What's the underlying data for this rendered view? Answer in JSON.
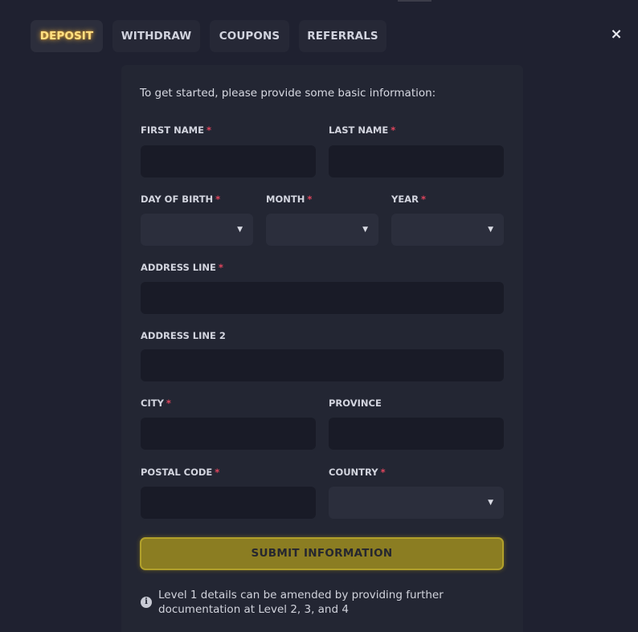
{
  "tabs": [
    {
      "label": "DEPOSIT",
      "active": true
    },
    {
      "label": "WITHDRAW",
      "active": false
    },
    {
      "label": "COUPONS",
      "active": false
    },
    {
      "label": "REFERRALS",
      "active": false
    }
  ],
  "close_icon": "×",
  "form": {
    "intro": "To get started, please provide some basic information:",
    "required_marker": "*",
    "first_name": {
      "label": "FIRST NAME",
      "value": ""
    },
    "last_name": {
      "label": "LAST NAME",
      "value": ""
    },
    "day_of_birth": {
      "label": "DAY OF BIRTH",
      "value": ""
    },
    "month": {
      "label": "MONTH",
      "value": ""
    },
    "year": {
      "label": "YEAR",
      "value": ""
    },
    "address_line": {
      "label": "ADDRESS LINE",
      "value": ""
    },
    "address_line_2": {
      "label": "ADDRESS LINE 2",
      "value": ""
    },
    "city": {
      "label": "CITY",
      "value": ""
    },
    "province": {
      "label": "PROVINCE",
      "value": ""
    },
    "postal_code": {
      "label": "POSTAL CODE",
      "value": ""
    },
    "country": {
      "label": "COUNTRY",
      "value": ""
    },
    "caret": "▼",
    "submit_label": "SUBMIT INFORMATION",
    "info_icon": "i",
    "info_text": "Level 1 details can be amended by providing further documentation at Level 2, 3, and 4"
  },
  "colors": {
    "background": "#1f2130",
    "panel": "#232633",
    "input": "#191b27",
    "select": "#2b2e3c",
    "tab": "#262836",
    "active_tab_text": "#ffe082",
    "required": "#e0455d",
    "submit": "#8b7d22"
  },
  "icons": {
    "close": "close-icon",
    "dropdown": "chevron-down-icon",
    "info": "info-icon"
  }
}
